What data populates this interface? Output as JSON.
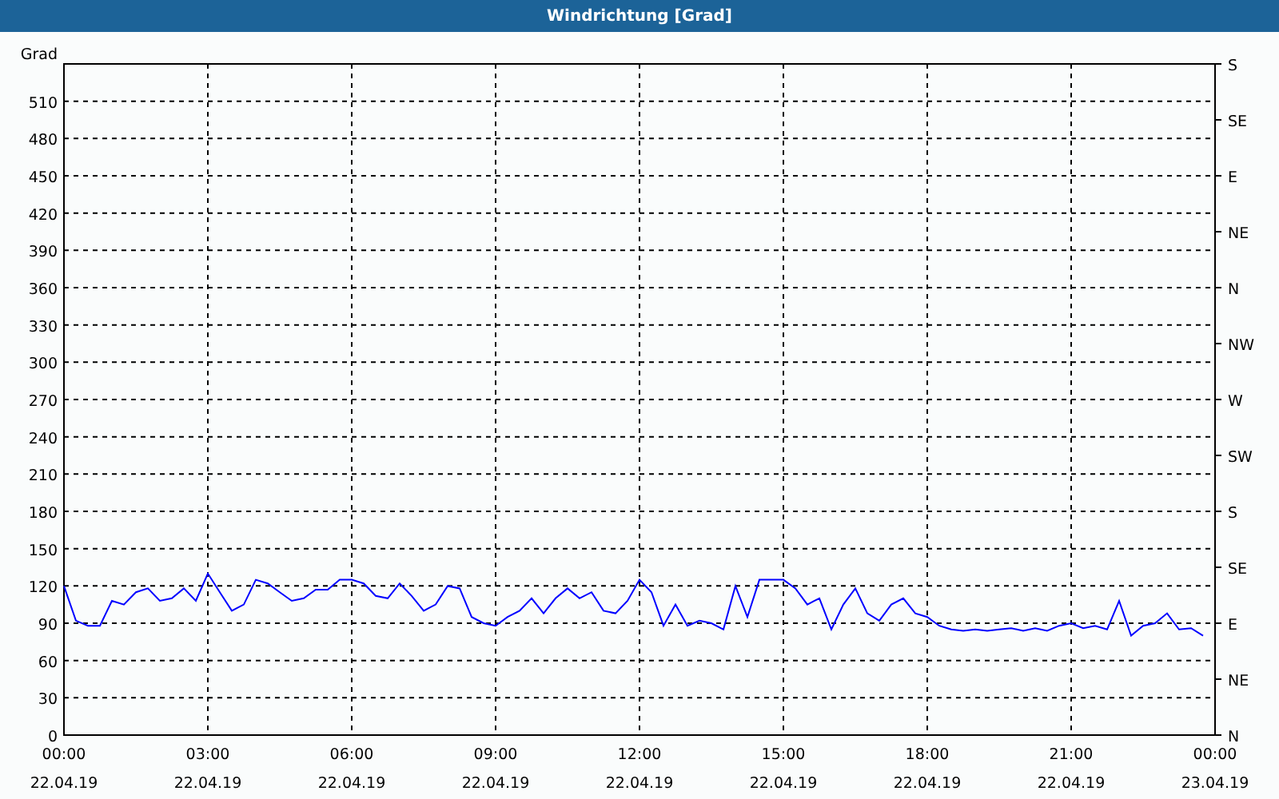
{
  "window": {
    "title": "Windrichtung [Grad]"
  },
  "chart": {
    "chart_data": {
      "type": "line",
      "ylabel": "Grad",
      "grid": true,
      "xlim": [
        0,
        24
      ],
      "ylim": [
        0,
        540
      ],
      "x": [
        0,
        0.25,
        0.5,
        0.75,
        1,
        1.25,
        1.5,
        1.75,
        2,
        2.25,
        2.5,
        2.75,
        3,
        3.25,
        3.5,
        3.75,
        4,
        4.25,
        4.5,
        4.75,
        5,
        5.25,
        5.5,
        5.75,
        6,
        6.25,
        6.5,
        6.75,
        7,
        7.25,
        7.5,
        7.75,
        8,
        8.25,
        8.5,
        8.75,
        9,
        9.25,
        9.5,
        9.75,
        10,
        10.25,
        10.5,
        10.75,
        11,
        11.25,
        11.5,
        11.75,
        12,
        12.25,
        12.5,
        12.75,
        13,
        13.25,
        13.5,
        13.75,
        14,
        14.25,
        14.5,
        14.75,
        15,
        15.25,
        15.5,
        15.75,
        16,
        16.25,
        16.5,
        16.75,
        17,
        17.25,
        17.5,
        17.75,
        18,
        18.25,
        18.5,
        18.75,
        19,
        19.25,
        19.5,
        19.75,
        20,
        20.25,
        20.5,
        20.75,
        21,
        21.25,
        21.5,
        21.75,
        22,
        22.25,
        22.5,
        22.75,
        23,
        23.25,
        23.5,
        23.75
      ],
      "series": [
        {
          "color": "#0000ff",
          "values": [
            120,
            92,
            88,
            88,
            108,
            105,
            115,
            118,
            108,
            110,
            118,
            108,
            130,
            115,
            100,
            105,
            125,
            122,
            115,
            108,
            110,
            117,
            117,
            125,
            125,
            122,
            112,
            110,
            122,
            112,
            100,
            105,
            120,
            118,
            95,
            90,
            88,
            95,
            100,
            110,
            98,
            110,
            118,
            110,
            115,
            100,
            98,
            108,
            125,
            115,
            88,
            105,
            88,
            92,
            90,
            85,
            120,
            95,
            125,
            125,
            125,
            118,
            105,
            110,
            85,
            105,
            118,
            98,
            92,
            105,
            110,
            98,
            95,
            88,
            85,
            84,
            85,
            84,
            85,
            86,
            84,
            86,
            84,
            88,
            90,
            86,
            88,
            85,
            108,
            80,
            88,
            90,
            98,
            85,
            86,
            80
          ]
        }
      ],
      "xticks": [
        {
          "value": 0,
          "label": "00:00"
        },
        {
          "value": 3,
          "label": "03:00"
        },
        {
          "value": 6,
          "label": "06:00"
        },
        {
          "value": 9,
          "label": "09:00"
        },
        {
          "value": 12,
          "label": "12:00"
        },
        {
          "value": 15,
          "label": "15:00"
        },
        {
          "value": 18,
          "label": "18:00"
        },
        {
          "value": 21,
          "label": "21:00"
        },
        {
          "value": 24,
          "label": "00:00"
        }
      ],
      "yticks": [
        0,
        30,
        60,
        90,
        120,
        150,
        180,
        210,
        240,
        270,
        300,
        330,
        360,
        390,
        420,
        450,
        480,
        510
      ]
    },
    "x_date_labels": [
      "22.04.19",
      "22.04.19",
      "22.04.19",
      "22.04.19",
      "22.04.19",
      "22.04.19",
      "22.04.19",
      "22.04.19",
      "23.04.19"
    ],
    "compass_labels": [
      "S",
      "SE",
      "E",
      "NE",
      "N",
      "NW",
      "W",
      "SW",
      "S",
      "SE",
      "E",
      "NE",
      "N"
    ]
  }
}
